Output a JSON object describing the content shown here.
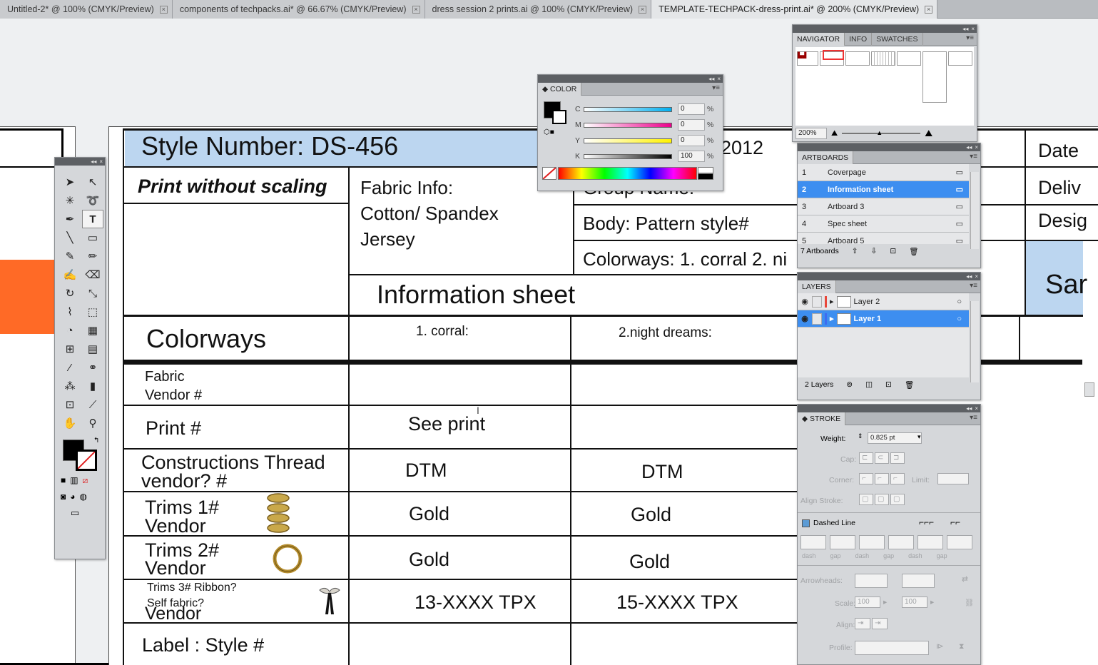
{
  "tabs": [
    {
      "label": "Untitled-2* @ 100% (CMYK/Preview)",
      "active": false
    },
    {
      "label": "components of techpacks.ai* @ 66.67% (CMYK/Preview)",
      "active": false
    },
    {
      "label": "dress session 2 prints.ai @ 100% (CMYK/Preview)",
      "active": false
    },
    {
      "label": "TEMPLATE-TECHPACK-dress-print.ai* @ 200% (CMYK/Preview)",
      "active": true
    }
  ],
  "techpack": {
    "style_number": "Style  Number: DS-456",
    "print_note": "Print without scaling",
    "fabric_info_1": "Fabric Info:",
    "fabric_info_2": "Cotton/ Spandex",
    "fabric_info_3": "Jersey",
    "year_fragment": "2012",
    "group_name": "Group Name:",
    "body": "Body: Pattern style#",
    "colorways_header": "Colorways: 1. corral 2. ni",
    "sheet_title": "Information sheet",
    "right_date": "Date",
    "right_deliv": "Deliv",
    "right_desig": "Desig",
    "right_sar": "Sar",
    "colorways_label": "Colorways",
    "col1": "1. corral:",
    "col2": "2.night dreams:",
    "rows": [
      {
        "label1": "Fabric",
        "label2": "Vendor #",
        "c1": "",
        "c2": ""
      },
      {
        "label1": "Print #",
        "label2": "",
        "c1": "See print",
        "c2": ""
      },
      {
        "label1": "Constructions Thread",
        "label2": "vendor? #",
        "c1": "DTM",
        "c2": "DTM"
      },
      {
        "label1": "Trims 1#",
        "label2": "Vendor",
        "c1": "Gold",
        "c2": "Gold"
      },
      {
        "label1": "Trims 2#",
        "label2": "Vendor",
        "c1": "Gold",
        "c2": "Gold"
      },
      {
        "label1": "Trims 3# Ribbon?",
        "label2": "Self fabric?",
        "label3": "Vendor",
        "c1": "13-XXXX TPX",
        "c2": "15-XXXX TPX"
      },
      {
        "label1": "Label : Style #",
        "label2": "",
        "c1": "",
        "c2": ""
      }
    ]
  },
  "color_panel": {
    "title": "COLOR",
    "channels": [
      {
        "name": "C",
        "value": "0"
      },
      {
        "name": "M",
        "value": "0"
      },
      {
        "name": "Y",
        "value": "0"
      },
      {
        "name": "K",
        "value": "100"
      }
    ],
    "unit": "%"
  },
  "navigator_panel": {
    "tabs": [
      "NAVIGATOR",
      "INFO",
      "SWATCHES"
    ],
    "zoom": "200%"
  },
  "artboards_panel": {
    "title": "ARTBOARDS",
    "items": [
      {
        "num": "1",
        "name": "Coverpage",
        "selected": false
      },
      {
        "num": "2",
        "name": "Information sheet",
        "selected": true
      },
      {
        "num": "3",
        "name": "Artboard 3",
        "selected": false
      },
      {
        "num": "4",
        "name": "Spec sheet",
        "selected": false
      },
      {
        "num": "5",
        "name": "Artboard 5",
        "selected": false
      }
    ],
    "footer": "7 Artboards"
  },
  "layers_panel": {
    "title": "LAYERS",
    "items": [
      {
        "name": "Layer 2",
        "selected": false,
        "color": "#e8473a"
      },
      {
        "name": "Layer 1",
        "selected": true,
        "color": "#3d6cf0"
      }
    ],
    "footer": "2 Layers"
  },
  "stroke_panel": {
    "title": "STROKE",
    "weight_label": "Weight:",
    "weight_value": "0.825 pt",
    "cap_label": "Cap:",
    "corner_label": "Corner:",
    "limit_label": "Limit:",
    "align_label": "Align Stroke:",
    "dashed_label": "Dashed Line",
    "dash_labels": [
      "dash",
      "gap",
      "dash",
      "gap",
      "dash",
      "gap"
    ],
    "arrowheads_label": "Arrowheads:",
    "scale_label": "Scale:",
    "scale_1": "100",
    "scale_2": "100",
    "align_label2": "Align:",
    "profile_label": "Profile:"
  },
  "colors": {
    "header_blue": "#bcd6f0",
    "orange": "#ff6a26",
    "selection_blue": "#3d8ef0"
  }
}
